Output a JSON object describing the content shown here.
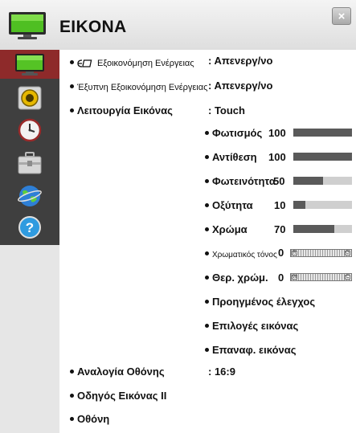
{
  "window": {
    "title": "EIKONA",
    "close_symbol": "×"
  },
  "sidebar": {
    "items": [
      {
        "icon": "tv-picture-icon",
        "active": true
      },
      {
        "icon": "speaker-icon",
        "active": false
      },
      {
        "icon": "clock-icon",
        "active": false
      },
      {
        "icon": "toolbox-icon",
        "active": false
      },
      {
        "icon": "globe-icon",
        "active": false
      },
      {
        "icon": "help-icon",
        "symbol": "?",
        "active": false
      }
    ]
  },
  "menu": {
    "energy_saving": {
      "label": "Εξοικονόμηση Ενέργειας",
      "value": ": Απενεργ/νο"
    },
    "smart_energy": {
      "label": "Έξυπνη Εξοικονόμηση Ενέργειας",
      "value": ": Απενεργ/νο"
    },
    "picture_mode": {
      "label": "Λειτουργία Εικόνας",
      "value": ": Touch"
    },
    "sliders": [
      {
        "label": "Φωτισμός",
        "value": "100",
        "level": 100
      },
      {
        "label": "Αντίθεση",
        "value": "100",
        "level": 100
      },
      {
        "label": "Φωτεινότητα",
        "value": "50",
        "level": 50
      },
      {
        "label": "Οξύτητα",
        "value": "10",
        "level": 20
      },
      {
        "label": "Χρώμα",
        "value": "70",
        "level": 70
      }
    ],
    "tint": {
      "label": "Χρωματικός τόνος",
      "value": "0",
      "left_cap": "R",
      "right_cap": "G"
    },
    "color_temp": {
      "label": "Θερ. χρώμ.",
      "value": "0",
      "left_cap": "W",
      "right_cap": "C"
    },
    "advanced_control": "Προηγμένος έλεγχος",
    "picture_options": "Επιλογές εικόνας",
    "picture_reset": "Επαναφ. εικόνας",
    "aspect_ratio": {
      "label": "Αναλογία Οθόνης",
      "value": ": 16:9"
    },
    "picture_wizard": "Οδηγός Εικόνας ΙΙ",
    "screen": "Οθόνη"
  },
  "colors": {
    "active_tab": "#8e2a2a",
    "sidebar_bg": "#3f3f3f",
    "bar_fill": "#5a5a5a",
    "bar_track": "#cfcfcf"
  }
}
